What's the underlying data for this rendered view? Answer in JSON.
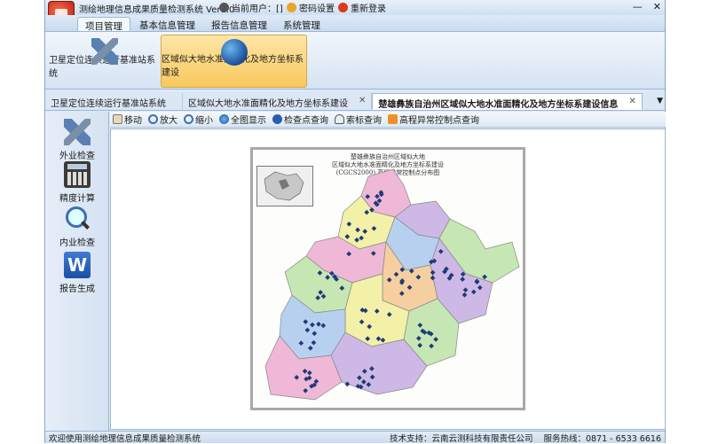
{
  "titlebar": {
    "app_title": "测绘地理信息成果质量检测系统 Ver1.0",
    "current_user_label": "当前用户：[]",
    "password_label": "密码设置",
    "relogin_label": "重新登录",
    "minimize": "—",
    "close": "✕"
  },
  "ribbon": {
    "tabs": [
      {
        "label": "项目管理"
      },
      {
        "label": "基本信息管理"
      },
      {
        "label": "报告信息管理"
      },
      {
        "label": "系统管理"
      }
    ],
    "buttons": [
      {
        "label": "卫星定位连续运行基准站系统",
        "icon": "satellite-icon"
      },
      {
        "label": "区域似大地水准面精化及地方坐标系建设",
        "icon": "globe-icon"
      }
    ]
  },
  "doc_tabs": [
    {
      "label": "卫星定位连续运行基准站系统",
      "close": ""
    },
    {
      "label": "区域似大地水准面精化及地方坐标系建设",
      "close": "✕"
    },
    {
      "label": "楚雄彝族自治州区域似大地水准面精化及地方坐标系建设信息",
      "close": "✕"
    }
  ],
  "tab_dropdown": "▼",
  "left_tools": [
    {
      "label": "外业检查",
      "icon": "satellite-icon"
    },
    {
      "label": "精度计算",
      "icon": "calculator-icon"
    },
    {
      "label": "内业检查",
      "icon": "magnifier-icon"
    },
    {
      "label": "报告生成",
      "icon": "word-icon"
    }
  ],
  "map_tools": [
    {
      "label": "移动",
      "icon": "hand-icon"
    },
    {
      "label": "放大",
      "icon": "zoom-in-icon"
    },
    {
      "label": "缩小",
      "icon": "zoom-out-icon"
    },
    {
      "label": "全图显示",
      "icon": "full-extent-icon"
    },
    {
      "label": "检查点查询",
      "icon": "info-icon"
    },
    {
      "label": "索标查询",
      "icon": "anchor-icon"
    },
    {
      "label": "高程异常控制点查询",
      "icon": "rss-icon"
    }
  ],
  "map": {
    "title_line1": "楚雄彝族自治州区域似大地",
    "title_line2": "区域似大地水准面精化及地方坐标系建设",
    "title_line3": "(CGCS2000) 高程异常控制点分布图",
    "colors": {
      "pink": "#efb8d6",
      "green": "#c6e6b4",
      "yellow": "#f3f0a8",
      "purple": "#cdb8e6",
      "blue": "#b8d0f0",
      "orange": "#f5cfa0",
      "border": "#888888",
      "marker": "#1f3a78"
    }
  },
  "statusbar": {
    "welcome": "欢迎使用测绘地理信息成果质量检测系统",
    "support": "技术支持：云南云测科技有限责任公司",
    "hotline": "服务热线：0871 - 6533 6616"
  }
}
